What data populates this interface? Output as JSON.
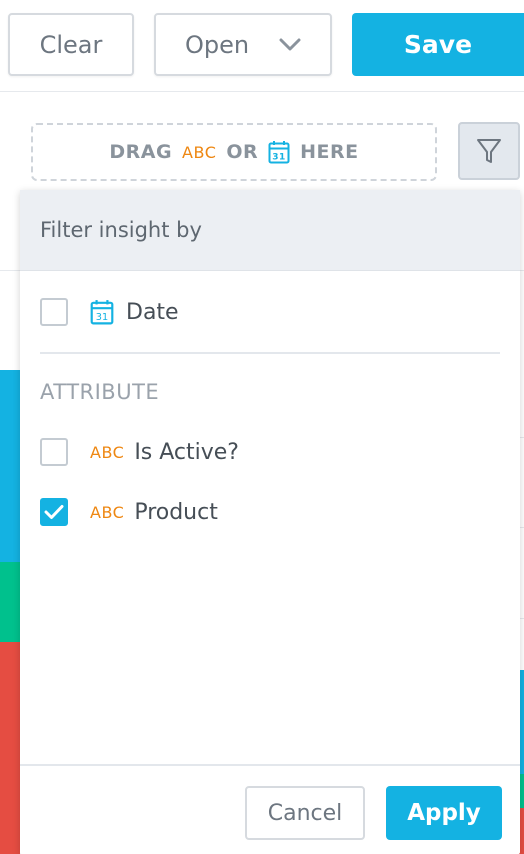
{
  "toolbar": {
    "clear_label": "Clear",
    "open_label": "Open",
    "save_label": "Save"
  },
  "dropzone": {
    "drag": "DRAG",
    "abc": "ABC",
    "or": "OR",
    "here": "HERE",
    "calendar_number": "31"
  },
  "panel": {
    "title": "Filter insight by",
    "date_item": {
      "label": "Date",
      "checked": false,
      "calendar_number": "31"
    },
    "attribute_section": "ATTRIBUTE",
    "attributes": [
      {
        "type": "ABC",
        "label": "Is Active?",
        "checked": false
      },
      {
        "type": "ABC",
        "label": "Product",
        "checked": true
      }
    ],
    "cancel_label": "Cancel",
    "apply_label": "Apply"
  },
  "colors": {
    "accent": "#14b2e2",
    "abc": "#ee8712",
    "green": "#00c18d",
    "red": "#e54d42"
  }
}
